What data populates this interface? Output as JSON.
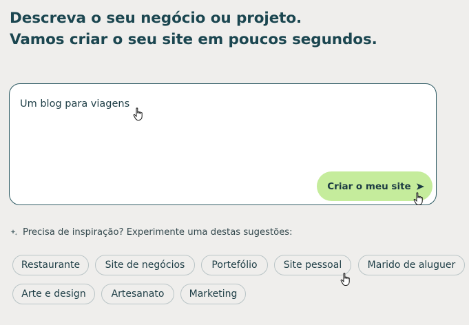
{
  "heading": {
    "line1": "Descreva o seu negócio ou projeto.",
    "line2": "Vamos criar o seu site em poucos segundos."
  },
  "prompt": {
    "value": "Um blog para viagens"
  },
  "submit_button": {
    "label": "Criar o meu site",
    "icon": "send-arrow-icon",
    "background": "#c5ec9c"
  },
  "inspiration": {
    "icon": "sparkle-icon",
    "text": "Precisa de inspiração? Experimente uma destas sugestões:",
    "suggestions": [
      "Restaurante",
      "Site de negócios",
      "Portefólio",
      "Site pessoal",
      "Marido de aluguer",
      "Arte e design",
      "Artesanato",
      "Marketing"
    ]
  },
  "colors": {
    "page_background": "#efeeec",
    "heading": "#1b4650",
    "box_border": "#2d5a63",
    "chip_border": "#b9c4c6"
  }
}
